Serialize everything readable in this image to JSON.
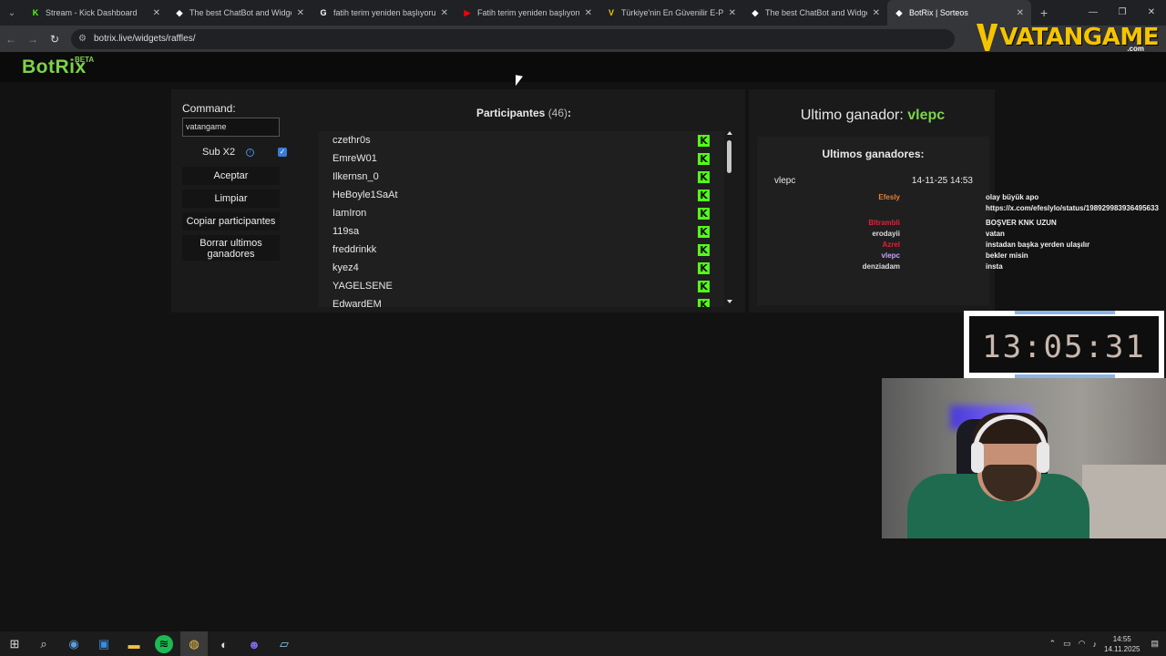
{
  "browser": {
    "tabs": [
      {
        "label": "Stream - Kick Dashboard",
        "icon": "kick-icon",
        "color": "#53fc18",
        "glyph": "K",
        "active": false
      },
      {
        "label": "The best ChatBot and Widgets",
        "icon": "botrix-icon",
        "color": "#ffffff",
        "glyph": "◆",
        "active": false
      },
      {
        "label": "fatih terim yeniden başlıyoruz",
        "icon": "google-icon",
        "color": "#ffffff",
        "glyph": "G",
        "active": false
      },
      {
        "label": "Fatih terim yeniden başlıyoruz",
        "icon": "youtube-icon",
        "color": "#ff0000",
        "glyph": "▶",
        "active": false
      },
      {
        "label": "Türkiye'nin En Güvenilir E-Pin ve",
        "icon": "vatangame-icon",
        "color": "#f5c400",
        "glyph": "V",
        "active": false
      },
      {
        "label": "The best ChatBot and Widgets",
        "icon": "botrix-icon",
        "color": "#ffffff",
        "glyph": "◆",
        "active": false
      },
      {
        "label": "BotRix | Sorteos",
        "icon": "botrix-icon",
        "color": "#ffffff",
        "glyph": "◆",
        "active": true
      }
    ],
    "url": "botrix.live/widgets/raffles/"
  },
  "overlay_logo": {
    "text": "VATANGAME",
    "suffix": ".com"
  },
  "site": {
    "brand": "BotRix",
    "brand_badge": "BETA"
  },
  "raffle": {
    "command_label": "Command:",
    "command_value": "vatangame",
    "sub_label": "Sub X2",
    "sub_checked": true,
    "accept_label": "Aceptar",
    "clear_label": "Limpiar",
    "copy_label": "Copiar participantes",
    "delete_label": "Borrar ultimos ganadores",
    "participants_title": "Participantes",
    "participants_count": "(46)",
    "participants_suffix": ":",
    "participants": [
      "czethr0s",
      "EmreW01",
      "Ilkernsn_0",
      "HeBoyle1SaAt",
      "IamIron",
      "119sa",
      "freddrinkk",
      "kyez4",
      "YAGELSENE",
      "EdwardEM"
    ]
  },
  "winners": {
    "last_winner_label": "Ultimo ganador:",
    "last_winner_name": "vlepc",
    "list_title": "Ultimos ganadores:",
    "list": [
      {
        "name": "vlepc",
        "date": "14-11-25 14:53"
      }
    ]
  },
  "chat": [
    {
      "user": "Efesly",
      "color": "#e0803a",
      "msg": "olay büyük apo"
    },
    {
      "user": "",
      "color": "#e0803a",
      "msg": "https://x.com/efeslylo/status/1989299839364956​33"
    },
    {
      "user": "Bltrambli",
      "color": "#e0203a",
      "msg": "BOŞVER KNK UZUN"
    },
    {
      "user": "erodayii",
      "color": "#dddddd",
      "msg": "vatan"
    },
    {
      "user": "Azrel",
      "color": "#e0203a",
      "msg": "instadan başka yerden ulaşılır"
    },
    {
      "user": "vlepc",
      "color": "#c7a0ff",
      "msg": "bekler misin"
    },
    {
      "user": "denziadam",
      "color": "#dddddd",
      "msg": "insta"
    }
  ],
  "clock": {
    "time": "13:05:31"
  },
  "taskbar": {
    "time": "14:55",
    "date": "14.11.2025"
  }
}
